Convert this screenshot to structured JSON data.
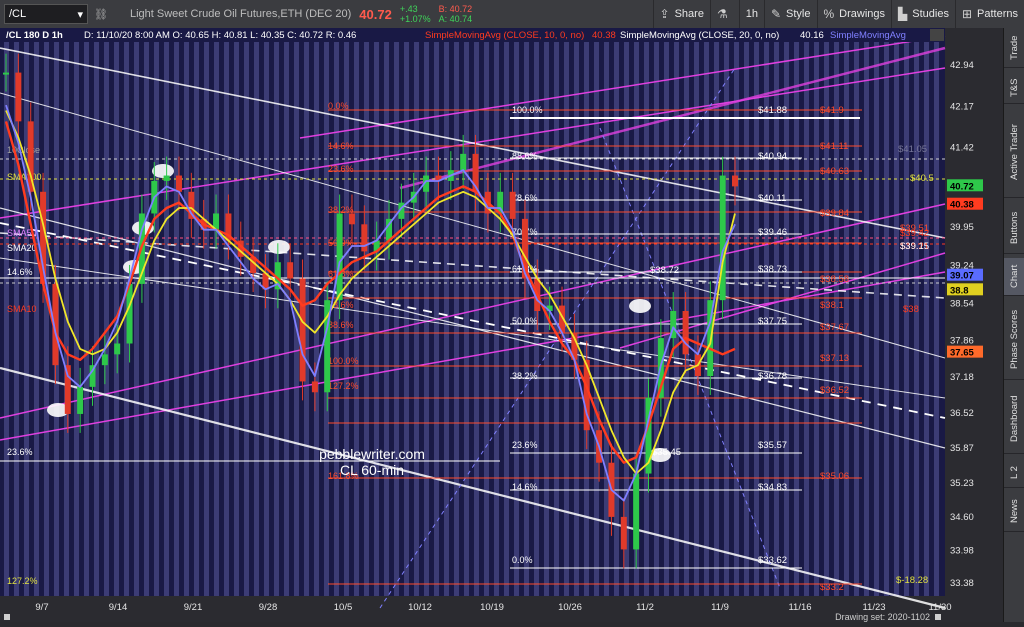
{
  "toolbar": {
    "symbol": "/CL",
    "description": "Light Sweet Crude Oil Futures,ETH (DEC 20)",
    "last_price": "40.72",
    "change": "+.43",
    "change_pct": "+1.07%",
    "bid": "B: 40.72",
    "ask": "A: 40.74",
    "share_label": "Share",
    "timeframe_label": "1h",
    "style_label": "Style",
    "drawings_label": "Drawings",
    "studies_label": "Studies",
    "patterns_label": "Patterns"
  },
  "chart_header": {
    "title": "/CL 180 D 1h",
    "ohlc": "D: 11/10/20 8:00 AM  O: 40.65  H: 40.81  L: 40.35  C: 40.72  R: 0.46",
    "study1": "SimpleMovingAvg (CLOSE, 10, 0, no)",
    "study1_value": "40.38",
    "study2": "SimpleMovingAvg (CLOSE, 20, 0, no)",
    "study2_value": "40.16",
    "study3": "SimpleMovingAvg"
  },
  "right_tabs": [
    "Trade",
    "T&S",
    "Active Trader",
    "Buttons",
    "Chart",
    "Phase Scores",
    "Dashboard",
    "L 2",
    "News"
  ],
  "watermark": [
    "pebblewriter.com",
    "CL 60-min"
  ],
  "drawing_set": "Drawing set: 2020-1102",
  "colors": {
    "background": "#191945",
    "stripe": "#5a5a9c",
    "sma10": "#ff3b1f",
    "sma20": "#f0e62a",
    "sma100": "#e0e040",
    "sma50": "#7f7fff",
    "fib_white": "#ffffff",
    "fib_red": "#ff4b2b",
    "channel_magenta": "#e040e0",
    "price_green": "#2ec84a",
    "price_red": "#e03a2a"
  },
  "chart_data": {
    "type": "line",
    "title": "/CL 180 D 1h",
    "xlabel": "",
    "ylabel": "",
    "ylim": [
      33.38,
      42.94
    ],
    "x_ticks": [
      "9/7",
      "9/14",
      "9/21",
      "9/28",
      "10/5",
      "10/12",
      "10/19",
      "10/26",
      "11/2",
      "11/9",
      "11/16",
      "11/23",
      "11/30"
    ],
    "y_ticks": [
      42.94,
      42.17,
      41.42,
      40.69,
      39.95,
      39.24,
      38.54,
      37.86,
      37.18,
      36.52,
      35.87,
      35.23,
      34.6,
      33.98,
      33.38
    ],
    "series": [
      {
        "name": "Close",
        "color": "#2ec84a",
        "values": [
          42.8,
          41.9,
          40.6,
          38.9,
          37.4,
          36.5,
          37.0,
          37.4,
          37.6,
          37.8,
          38.9,
          40.2,
          40.8,
          40.9,
          40.6,
          40.1,
          39.9,
          40.2,
          39.7,
          39.4,
          39.1,
          38.8,
          39.3,
          39.0,
          37.1,
          36.9,
          38.6,
          40.2,
          40.0,
          39.5,
          39.7,
          40.1,
          40.4,
          40.6,
          40.9,
          40.8,
          41.0,
          41.3,
          40.6,
          40.2,
          40.6,
          40.1,
          39.0,
          38.4,
          38.5,
          38.0,
          37.5,
          36.2,
          35.6,
          34.6,
          34.0,
          35.4,
          36.8,
          37.9,
          38.4,
          37.6,
          37.2,
          38.6,
          40.9,
          40.7
        ]
      },
      {
        "name": "SMA10",
        "color": "#ff3b1f",
        "values": [
          41.9,
          41.1,
          40.0,
          38.9,
          38.0,
          37.6,
          37.5,
          37.7,
          38.0,
          38.3,
          38.9,
          39.6,
          40.1,
          40.3,
          40.4,
          40.2,
          40.0,
          39.9,
          39.8,
          39.6,
          39.4,
          39.2,
          39.0,
          38.8,
          38.5,
          38.6,
          38.9,
          39.1,
          39.3,
          39.4,
          39.5,
          39.7,
          39.9,
          40.1,
          40.3,
          40.5,
          40.6,
          40.7,
          40.6,
          40.4,
          40.2,
          39.8,
          39.2,
          38.7,
          38.2,
          37.8,
          37.5,
          37.0,
          36.4,
          35.9,
          35.6,
          35.7,
          36.3,
          37.0,
          37.7,
          37.9,
          37.8,
          37.7,
          37.6,
          37.7
        ]
      },
      {
        "name": "SMA20",
        "color": "#f0e62a",
        "values": [
          42.1,
          41.6,
          40.9,
          40.0,
          39.0,
          38.2,
          37.7,
          37.6,
          37.7,
          38.0,
          38.5,
          39.1,
          39.7,
          40.1,
          40.3,
          40.3,
          40.1,
          39.9,
          39.7,
          39.5,
          39.3,
          39.1,
          38.9,
          38.6,
          38.2,
          38.0,
          38.3,
          38.7,
          39.0,
          39.2,
          39.4,
          39.6,
          39.8,
          40.0,
          40.2,
          40.4,
          40.5,
          40.6,
          40.5,
          40.3,
          40.1,
          39.8,
          39.4,
          39.0,
          38.7,
          38.3,
          37.9,
          37.4,
          36.8,
          36.2,
          35.7,
          35.4,
          35.6,
          36.2,
          36.9,
          37.3,
          37.4,
          37.8,
          39.3,
          40.2
        ]
      },
      {
        "name": "SMA50",
        "color": "#7f7fff",
        "values": [
          42.2,
          41.5,
          40.5,
          39.2,
          38.0,
          37.2,
          37.0,
          37.3,
          37.7,
          38.2,
          39.0,
          39.9,
          40.5,
          40.7,
          40.6,
          40.2,
          39.9,
          39.9,
          39.6,
          39.3,
          39.0,
          38.8,
          38.9,
          38.6,
          37.6,
          37.2,
          38.1,
          39.3,
          39.6,
          39.6,
          39.7,
          40.0,
          40.3,
          40.5,
          40.8,
          40.8,
          40.9,
          41.0,
          40.7,
          40.3,
          40.3,
          39.9,
          39.1,
          38.6,
          38.4,
          38.0,
          37.5,
          36.5,
          35.9,
          35.1,
          34.9,
          35.4,
          36.4,
          37.4,
          38.1,
          37.8,
          37.6,
          38.2,
          39.5,
          40.0
        ]
      }
    ],
    "fib_labels": [
      {
        "pct": "0.0%",
        "y": 41.88
      },
      {
        "pct": "14.6%",
        "y": 41.11
      },
      {
        "pct": "23.6%",
        "y": 40.63
      },
      {
        "pct": "38.2%",
        "y": 39.84
      },
      {
        "pct": "50.0%",
        "y": 39.21
      },
      {
        "pct": "61.8%",
        "y": 38.58
      },
      {
        "pct": "78.6%",
        "y": 37.67
      },
      {
        "pct": "88.6%",
        "y": 37.13
      },
      {
        "pct": "100.0%",
        "y": 36.52
      },
      {
        "pct": "127.2%",
        "y": 35.06
      },
      {
        "pct": "161.8%",
        "y": 33.2
      }
    ],
    "fib_white_labels": [
      {
        "pct": "100.0%",
        "y": 41.88
      },
      {
        "pct": "88.6%",
        "y": 40.94
      },
      {
        "pct": "78.6%",
        "y": 40.11
      },
      {
        "pct": "70.7%",
        "y": 39.46
      },
      {
        "pct": "61.8%",
        "y": 38.73
      },
      {
        "pct": "50.0%",
        "y": 37.75
      },
      {
        "pct": "38.2%",
        "y": 36.78
      },
      {
        "pct": "23.6%",
        "y": 35.57
      },
      {
        "pct": "14.6%",
        "y": 34.83
      },
      {
        "pct": "0.0%",
        "y": 33.62
      }
    ],
    "fib_white_values": [
      "$41.88",
      "$40.94",
      "$40.11",
      "$39.46",
      "$38.73",
      "$37.75",
      "$36.78",
      "$35.57",
      "$34.83",
      "$33.62"
    ],
    "fib_red_values": [
      "$41.9",
      "$41.11",
      "$40.63",
      "$39.84",
      "$39.51",
      "$39.21",
      "$38.58",
      "$38.1",
      "$37.67",
      "$37.13",
      "$36.52",
      "$35.06",
      "$33.2"
    ],
    "left_labels": [
      "SMA100",
      "SMA50",
      "SMA20",
      "14.6%",
      "SMA10",
      "23.6%",
      "127.2%",
      "10Close"
    ],
    "annotations": [
      {
        "text": "$38.72",
        "y": 38.72
      },
      {
        "text": "$35.45",
        "y": 35.45
      },
      {
        "text": "$41.05",
        "y": 41.05
      },
      {
        "text": "$40.5",
        "y": 40.5
      },
      {
        "text": "$39.15",
        "y": 39.15
      },
      {
        "text": "$39.42",
        "y": 39.42
      },
      {
        "text": "$38",
        "y": 38.0
      },
      {
        "text": "$-18.28",
        "y": 33.4
      }
    ],
    "price_tags": [
      {
        "text": "40.72",
        "y": 40.72,
        "bg": "#2ec84a"
      },
      {
        "text": "40.38",
        "y": 40.38,
        "bg": "#ff3b1f"
      },
      {
        "text": "39.07",
        "y": 39.07,
        "bg": "#5a6cff"
      },
      {
        "text": "38.8",
        "y": 38.8,
        "bg": "#e0d020"
      },
      {
        "text": "37.65",
        "y": 37.65,
        "bg": "#ff6a2a"
      }
    ]
  }
}
